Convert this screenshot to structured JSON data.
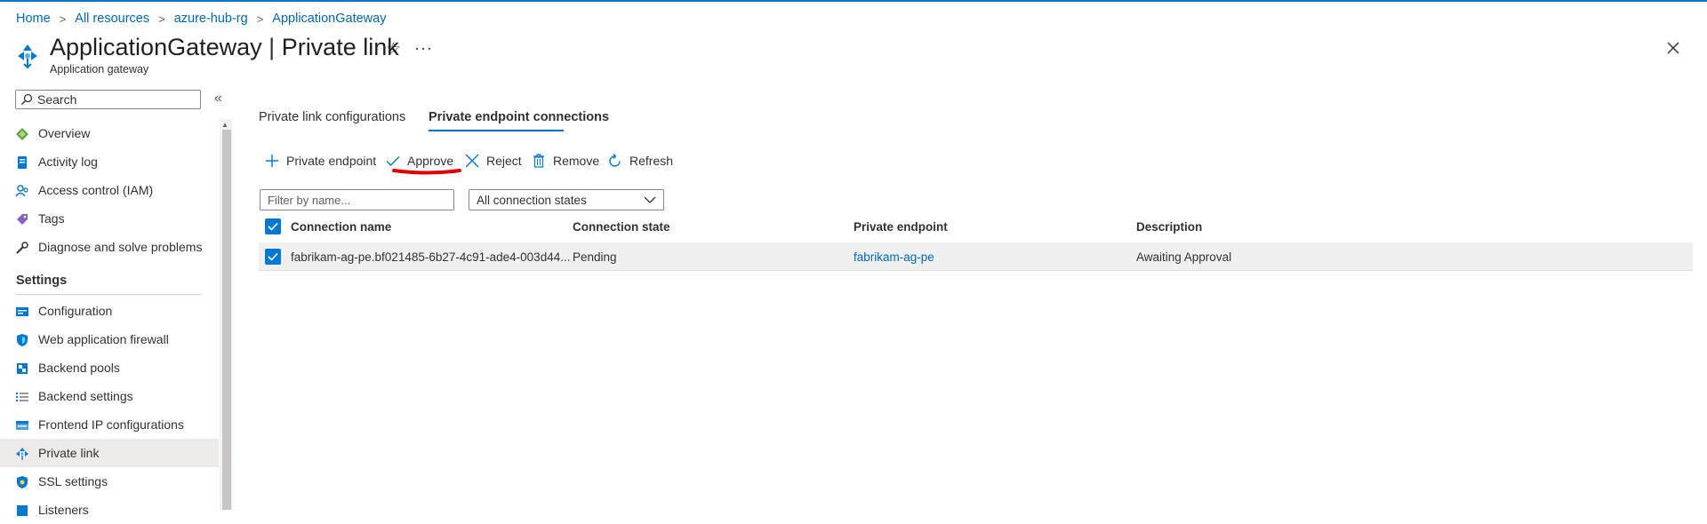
{
  "breadcrumb": [
    "Home",
    "All resources",
    "azure-hub-rg",
    "ApplicationGateway"
  ],
  "header": {
    "resource_name": "ApplicationGateway",
    "separator": "|",
    "blade_name": "Private link",
    "subtitle": "Application gateway",
    "star_icon": "star-icon",
    "more_icon": "more-icon",
    "close_icon": "close-icon"
  },
  "sidebar": {
    "search_placeholder": "Search",
    "collapse_glyph": "«",
    "items_top": [
      {
        "label": "Overview",
        "icon": "overview-icon"
      },
      {
        "label": "Activity log",
        "icon": "activity-log-icon"
      },
      {
        "label": "Access control (IAM)",
        "icon": "iam-icon"
      },
      {
        "label": "Tags",
        "icon": "tag-icon"
      },
      {
        "label": "Diagnose and solve problems",
        "icon": "wrench-icon"
      }
    ],
    "settings_heading": "Settings",
    "items_settings": [
      {
        "label": "Configuration",
        "icon": "configuration-icon"
      },
      {
        "label": "Web application firewall",
        "icon": "shield-icon"
      },
      {
        "label": "Backend pools",
        "icon": "backend-pools-icon"
      },
      {
        "label": "Backend settings",
        "icon": "list-settings-icon"
      },
      {
        "label": "Frontend IP configurations",
        "icon": "frontend-ip-icon"
      },
      {
        "label": "Private link",
        "icon": "private-link-icon",
        "selected": true
      },
      {
        "label": "SSL settings",
        "icon": "ssl-shield-icon"
      },
      {
        "label": "Listeners",
        "icon": "listeners-icon"
      }
    ]
  },
  "tabs": [
    {
      "label": "Private link configurations",
      "active": false
    },
    {
      "label": "Private endpoint connections",
      "active": true
    }
  ],
  "toolbar": {
    "add_endpoint": "Private endpoint",
    "approve": "Approve",
    "reject": "Reject",
    "remove": "Remove",
    "refresh": "Refresh"
  },
  "filters": {
    "name_placeholder": "Filter by name...",
    "state_selected": "All connection states"
  },
  "table": {
    "columns": [
      "Connection name",
      "Connection state",
      "Private endpoint",
      "Description"
    ],
    "rows": [
      {
        "connection_name": "fabrikam-ag-pe.bf021485-6b27-4c91-ade4-003d44...",
        "connection_state": "Pending",
        "private_endpoint": "fabrikam-ag-pe",
        "description": "Awaiting Approval",
        "checked": true
      }
    ]
  },
  "colors": {
    "accent": "#0078d4",
    "link": "#0067b8",
    "annotation": "#e00000",
    "selected_row": "#f0f0f0"
  }
}
